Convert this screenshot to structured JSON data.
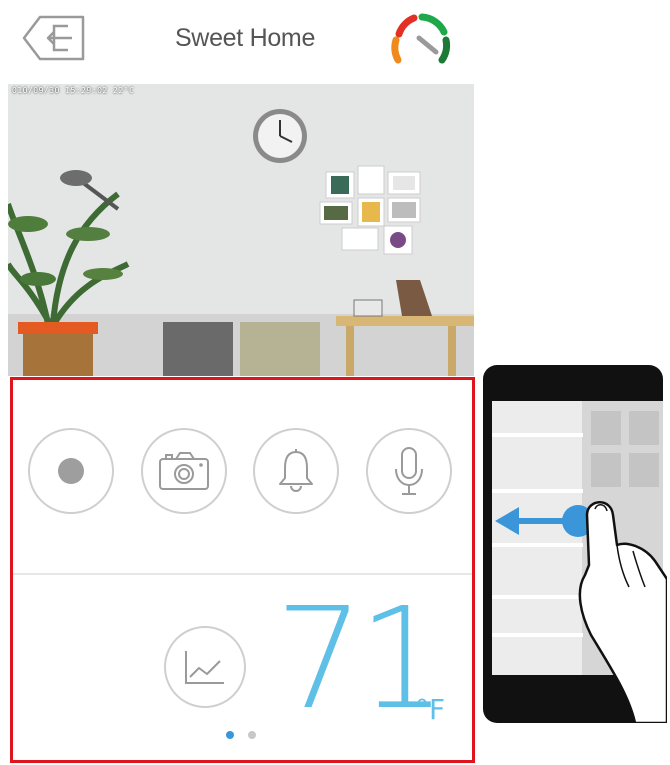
{
  "header": {
    "title": "Sweet Home",
    "back_icon": "exit-door-icon",
    "status_icon": "gauge-icon"
  },
  "camera": {
    "timestamp": "010/09/30 15:29:02 22°C"
  },
  "controls": {
    "buttons": [
      {
        "name": "record",
        "icon": "record-icon"
      },
      {
        "name": "snapshot",
        "icon": "camera-icon"
      },
      {
        "name": "alarm",
        "icon": "bell-icon"
      },
      {
        "name": "microphone",
        "icon": "microphone-icon"
      }
    ]
  },
  "temperature": {
    "value": "71",
    "unit": "°F",
    "history_icon": "chart-icon"
  },
  "pager": {
    "total": 2,
    "active": 1
  },
  "colors": {
    "accent": "#5ec0e6",
    "panel_border": "#e0141c",
    "swipe_arrow": "#3a96d8"
  },
  "gesture": {
    "type": "swipe-left",
    "icon": "hand-swipe-icon"
  }
}
